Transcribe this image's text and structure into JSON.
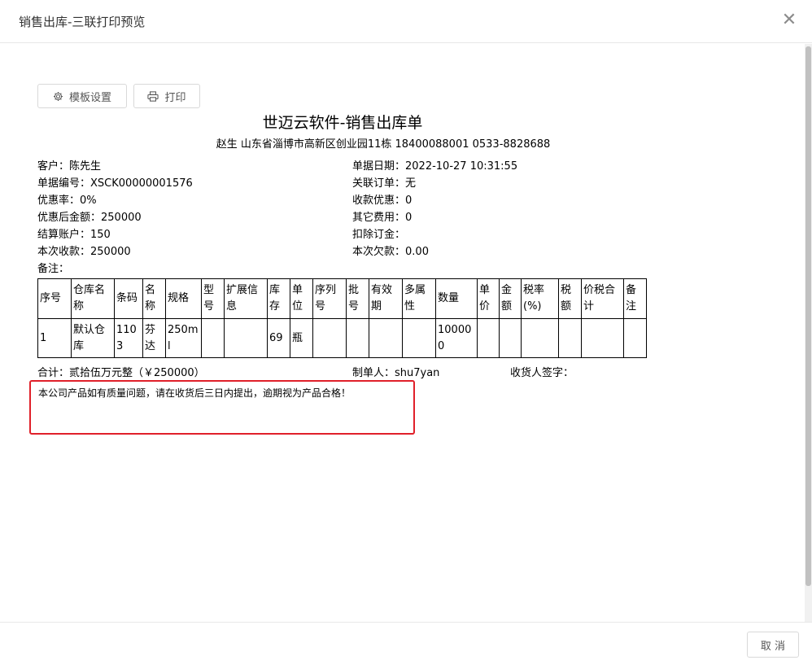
{
  "dialog": {
    "title": "销售出库-三联打印预览"
  },
  "toolbar": {
    "template_label": "模板设置",
    "print_label": "打印"
  },
  "document": {
    "title": "世迈云软件-销售出库单",
    "subtitle": "赵生 山东省淄博市高新区创业园11栋 18400088001 0533-8828688"
  },
  "fields_left": [
    {
      "label": "客户：",
      "value": "陈先生"
    },
    {
      "label": "单据编号：",
      "value": "XSCK00000001576"
    },
    {
      "label": "优惠率：",
      "value": "0%"
    },
    {
      "label": "优惠后金额：",
      "value": "250000"
    },
    {
      "label": "结算账户：",
      "value": "150"
    },
    {
      "label": "本次收款：",
      "value": "250000"
    },
    {
      "label": "备注：",
      "value": ""
    }
  ],
  "fields_right": [
    {
      "label": "单据日期：",
      "value": "2022-10-27 10:31:55"
    },
    {
      "label": "关联订单：",
      "value": "无"
    },
    {
      "label": "收款优惠：",
      "value": "0"
    },
    {
      "label": "其它费用：",
      "value": "0"
    },
    {
      "label": "扣除订金：",
      "value": ""
    },
    {
      "label": "本次欠款：",
      "value": "0.00"
    }
  ],
  "table": {
    "headers": [
      "序号",
      "仓库名称",
      "条码",
      "名称",
      "规格",
      "型号",
      "扩展信息",
      "库存",
      "单位",
      "序列号",
      "批号",
      "有效期",
      "多属性",
      "数量",
      "单价",
      "金额",
      "税率(%)",
      "税额",
      "价税合计",
      "备注"
    ],
    "rows": [
      [
        "1",
        "默认仓库",
        "1103",
        "芬达",
        "250ml",
        "",
        "",
        "69",
        "瓶",
        "",
        "",
        "",
        "",
        "100000",
        "",
        "",
        "",
        "",
        "",
        ""
      ]
    ]
  },
  "summary": {
    "total": "合计：贰拾伍万元整（￥250000）",
    "maker": "制单人：shu7yan",
    "receiver": "收货人签字："
  },
  "notice": "本公司产品如有质量问题，请在收货后三日内提出，逾期视为产品合格！",
  "footer": {
    "cancel_label": "取 消"
  },
  "colors": {
    "highlight_box": "#e0202a",
    "border": "#d9d9d9"
  }
}
